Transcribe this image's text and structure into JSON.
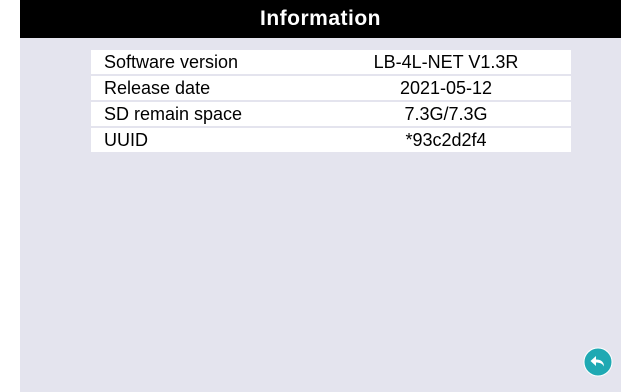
{
  "header": {
    "title": "Information"
  },
  "info": {
    "rows": [
      {
        "label": "Software version",
        "value": "LB-4L-NET V1.3R"
      },
      {
        "label": "Release date",
        "value": "2021-05-12"
      },
      {
        "label": "SD remain space",
        "value": "7.3G/7.3G"
      },
      {
        "label": "UUID",
        "value": "*93c2d2f4"
      }
    ]
  },
  "controls": {
    "back_icon": "back-arrow-icon",
    "accent_color": "#1fa9b3"
  }
}
